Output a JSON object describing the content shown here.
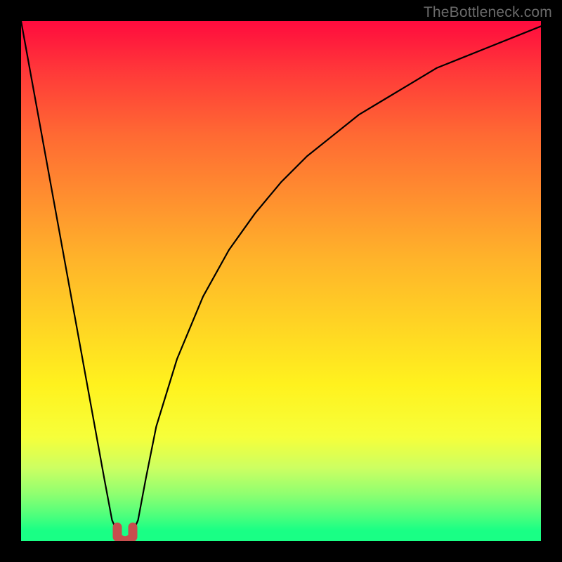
{
  "watermark": {
    "text": "TheBottleneck.com"
  },
  "chart_data": {
    "type": "line",
    "title": "",
    "xlabel": "",
    "ylabel": "",
    "xlim": [
      0,
      100
    ],
    "ylim": [
      0,
      100
    ],
    "grid": false,
    "legend": false,
    "background": "vertical-gradient red→yellow→green",
    "series": [
      {
        "name": "bottleneck-curve",
        "x": [
          0,
          2,
          4,
          6,
          8,
          10,
          12,
          14,
          16,
          17.5,
          18.8,
          19.5,
          20.5,
          21.2,
          22.5,
          24,
          26,
          30,
          35,
          40,
          45,
          50,
          55,
          60,
          65,
          70,
          75,
          80,
          85,
          90,
          95,
          100
        ],
        "values": [
          100,
          89,
          78,
          67,
          56,
          45,
          34,
          23,
          12,
          4,
          1,
          0.4,
          0.4,
          1,
          4,
          12,
          22,
          35,
          47,
          56,
          63,
          69,
          74,
          78,
          82,
          85,
          88,
          91,
          93,
          95,
          97,
          99
        ]
      }
    ],
    "marker": {
      "name": "minimum-marker",
      "x": 20,
      "y": 0.5,
      "color": "#c84e4e"
    }
  }
}
